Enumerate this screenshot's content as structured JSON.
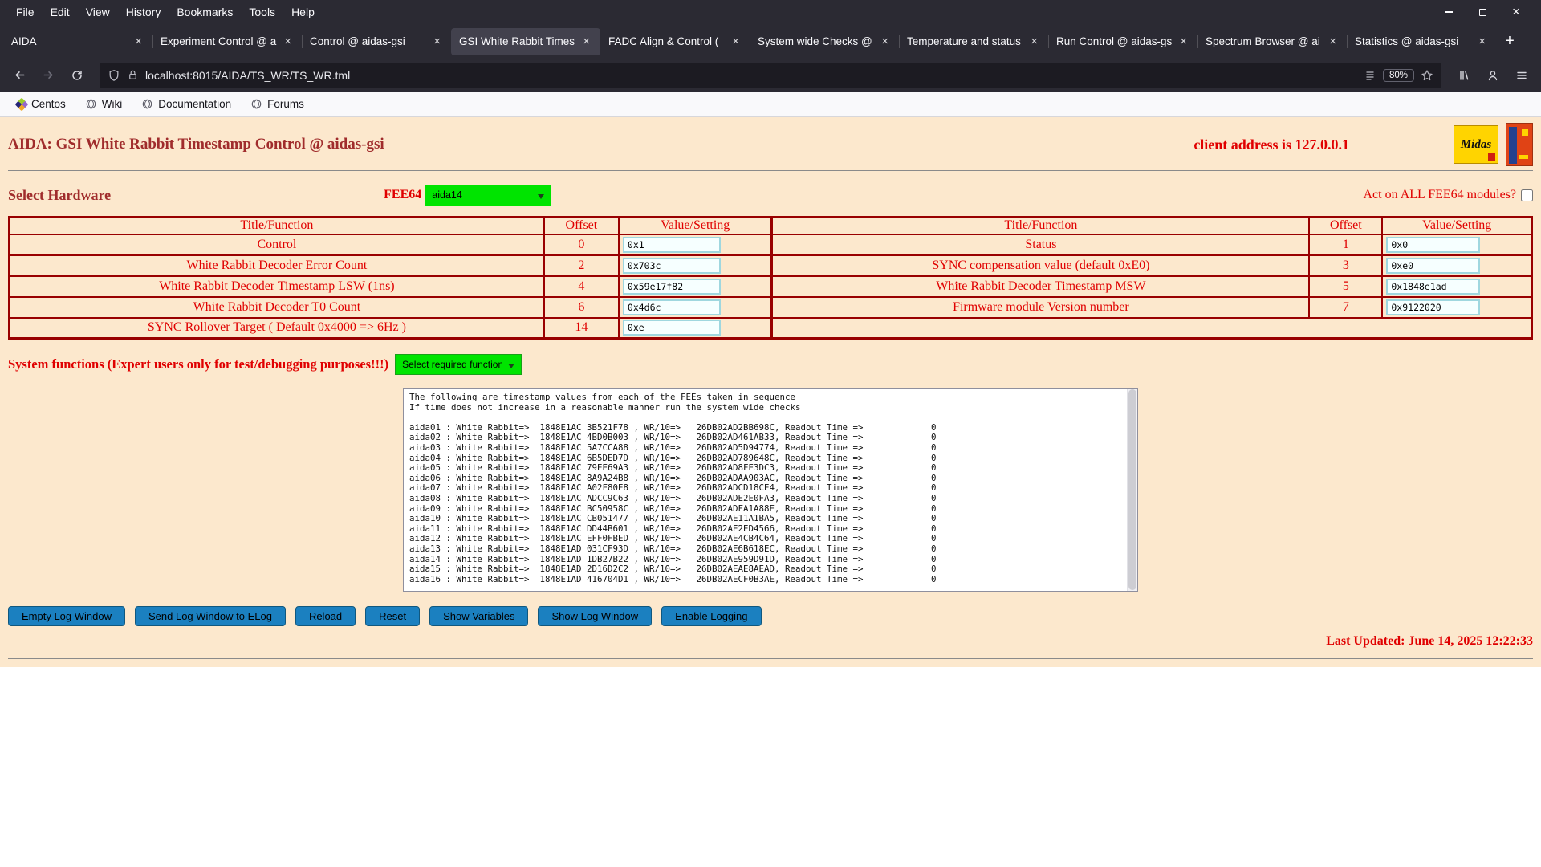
{
  "browser": {
    "menu": [
      "File",
      "Edit",
      "View",
      "History",
      "Bookmarks",
      "Tools",
      "Help"
    ],
    "tabs": [
      {
        "label": "AIDA"
      },
      {
        "label": "Experiment Control @ a"
      },
      {
        "label": "Control @ aidas-gsi"
      },
      {
        "label": "GSI White Rabbit Times"
      },
      {
        "label": "FADC Align & Control ("
      },
      {
        "label": "System wide Checks @"
      },
      {
        "label": "Temperature and status"
      },
      {
        "label": "Run Control @ aidas-gsi"
      },
      {
        "label": "Spectrum Browser @ ai"
      },
      {
        "label": "Statistics @ aidas-gsi"
      }
    ],
    "close_glyph": "×",
    "new_tab": "+",
    "url": "localhost:8015/AIDA/TS_WR/TS_WR.tml",
    "zoom": "80%",
    "bookmarks": [
      "Centos",
      "Wiki",
      "Documentation",
      "Forums"
    ]
  },
  "page": {
    "title": "AIDA: GSI White Rabbit Timestamp Control @ aidas-gsi",
    "client_address": "client address is 127.0.0.1",
    "logos": {
      "midas": "Midas"
    },
    "hardware": {
      "label": "Select Hardware",
      "fee64_label": "FEE64",
      "fee64_selected": "aida14",
      "act_all_label": "Act on ALL FEE64 modules?"
    },
    "table": {
      "headers": [
        "Title/Function",
        "Offset",
        "Value/Setting"
      ],
      "left_rows": [
        {
          "title": "Control",
          "offset": "0",
          "value": "0x1"
        },
        {
          "title": "White Rabbit Decoder Error Count",
          "offset": "2",
          "value": "0x703c"
        },
        {
          "title": "White Rabbit Decoder Timestamp LSW (1ns)",
          "offset": "4",
          "value": "0x59e17f82"
        },
        {
          "title": "White Rabbit Decoder T0 Count",
          "offset": "6",
          "value": "0x4d6c"
        },
        {
          "title": "SYNC Rollover Target ( Default 0x4000 => 6Hz )",
          "offset": "14",
          "value": "0xe"
        }
      ],
      "right_rows": [
        {
          "title": "Status",
          "offset": "1",
          "value": "0x0"
        },
        {
          "title": "SYNC compensation value (default 0xE0)",
          "offset": "3",
          "value": "0xe0"
        },
        {
          "title": "White Rabbit Decoder Timestamp MSW",
          "offset": "5",
          "value": "0x1848e1ad"
        },
        {
          "title": "Firmware module Version number",
          "offset": "7",
          "value": "0x9122020"
        }
      ]
    },
    "system_functions": {
      "label": "System functions (Expert users only for test/debugging purposes!!!)",
      "selected": "Select required function"
    },
    "log_lines": [
      "The following are timestamp values from each of the FEEs taken in sequence",
      "If time does not increase in a reasonable manner run the system wide checks",
      "",
      "aida01 : White Rabbit=>  1848E1AC 3B521F78 , WR/10=>   26DB02AD2BB698C, Readout Time =>             0",
      "aida02 : White Rabbit=>  1848E1AC 4BD0B003 , WR/10=>   26DB02AD461AB33, Readout Time =>             0",
      "aida03 : White Rabbit=>  1848E1AC 5A7CCA88 , WR/10=>   26DB02AD5D94774, Readout Time =>             0",
      "aida04 : White Rabbit=>  1848E1AC 6B5DED7D , WR/10=>   26DB02AD789648C, Readout Time =>             0",
      "aida05 : White Rabbit=>  1848E1AC 79EE69A3 , WR/10=>   26DB02AD8FE3DC3, Readout Time =>             0",
      "aida06 : White Rabbit=>  1848E1AC 8A9A24B8 , WR/10=>   26DB02ADAA903AC, Readout Time =>             0",
      "aida07 : White Rabbit=>  1848E1AC A02F80E8 , WR/10=>   26DB02ADCD18CE4, Readout Time =>             0",
      "aida08 : White Rabbit=>  1848E1AC ADCC9C63 , WR/10=>   26DB02ADE2E0FA3, Readout Time =>             0",
      "aida09 : White Rabbit=>  1848E1AC BC50958C , WR/10=>   26DB02ADFA1A88E, Readout Time =>             0",
      "aida10 : White Rabbit=>  1848E1AC CB051477 , WR/10=>   26DB02AE11A1BA5, Readout Time =>             0",
      "aida11 : White Rabbit=>  1848E1AC DD44B601 , WR/10=>   26DB02AE2ED4566, Readout Time =>             0",
      "aida12 : White Rabbit=>  1848E1AC EFF0FBED , WR/10=>   26DB02AE4CB4C64, Readout Time =>             0",
      "aida13 : White Rabbit=>  1848E1AD 031CF93D , WR/10=>   26DB02AE6B618EC, Readout Time =>             0",
      "aida14 : White Rabbit=>  1848E1AD 1DB27B22 , WR/10=>   26DB02AE959D91D, Readout Time =>             0",
      "aida15 : White Rabbit=>  1848E1AD 2D16D2C2 , WR/10=>   26DB02AEAE8AEAD, Readout Time =>             0",
      "aida16 : White Rabbit=>  1848E1AD 416704D1 , WR/10=>   26DB02AECF0B3AE, Readout Time =>             0"
    ],
    "buttons": [
      "Empty Log Window",
      "Send Log Window to ELog",
      "Reload",
      "Reset",
      "Show Variables",
      "Show Log Window",
      "Enable Logging"
    ],
    "last_updated": "Last Updated: June 14, 2025 12:22:33"
  }
}
